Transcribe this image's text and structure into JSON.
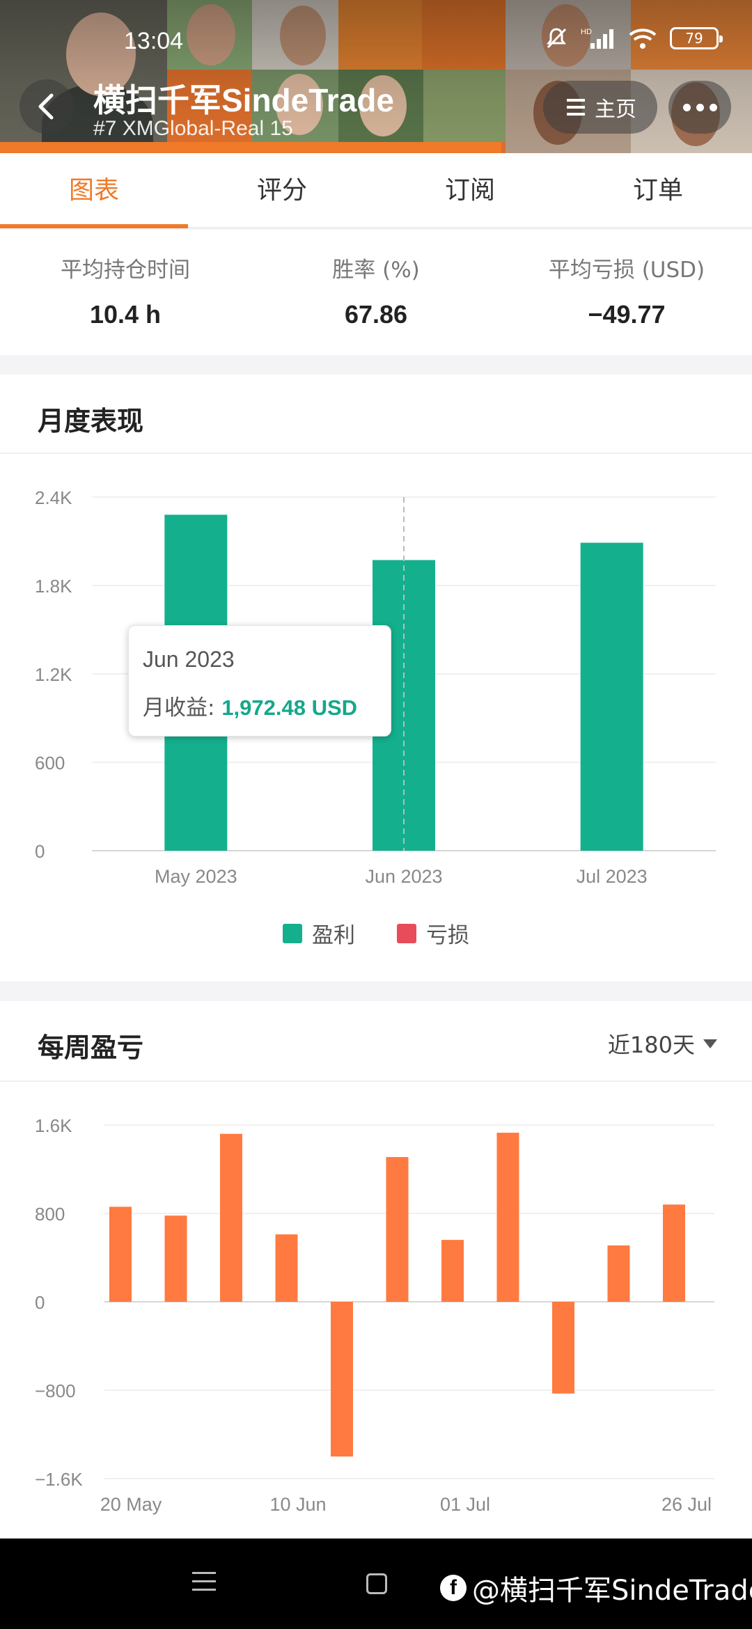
{
  "status_bar": {
    "time": "13:04",
    "battery": "79",
    "network_badge": "HD"
  },
  "header": {
    "title": "横扫千军SindeTrade",
    "subtitle": "#7  XMGlobal-Real 15",
    "home_label": "主页"
  },
  "tabs": [
    {
      "label": "图表",
      "active": true
    },
    {
      "label": "评分",
      "active": false
    },
    {
      "label": "订阅",
      "active": false
    },
    {
      "label": "订单",
      "active": false
    }
  ],
  "stats": [
    {
      "label": "平均持仓时间",
      "value": "10.4 h"
    },
    {
      "label": "胜率 (%)",
      "value": "67.86"
    },
    {
      "label": "平均亏损 (USD)",
      "value": "−49.77"
    }
  ],
  "monthly": {
    "title": "月度表现",
    "tooltip": {
      "date": "Jun 2023",
      "label": "月收益:",
      "value": "1,972.48 USD"
    },
    "legend": [
      {
        "name": "盈利",
        "color": "#14b08d"
      },
      {
        "name": "亏损",
        "color": "#e84c5a"
      }
    ]
  },
  "weekly": {
    "title": "每周盈亏",
    "range": "近180天"
  },
  "chart_data": [
    {
      "type": "bar",
      "title": "月度表现",
      "categories": [
        "May 2023",
        "Jun 2023",
        "Jul 2023"
      ],
      "values": [
        2280,
        1972.48,
        2090
      ],
      "ylim": [
        0,
        2400
      ],
      "yticks": [
        "0",
        "600",
        "1.2K",
        "1.8K",
        "2.4K"
      ],
      "ytick_values": [
        0,
        600,
        1200,
        1800,
        2400
      ],
      "color": "#14b08d",
      "grid": true,
      "legend": "bottom"
    },
    {
      "type": "bar",
      "title": "每周盈亏",
      "values": [
        860,
        780,
        1520,
        610,
        -1400,
        1310,
        560,
        1530,
        -830,
        510,
        880
      ],
      "xtick_labels": [
        "20 May",
        "10 Jun",
        "01 Jul",
        "26 Jul"
      ],
      "ylim": [
        -1600,
        1600
      ],
      "yticks": [
        "−1.6K",
        "−800",
        "0",
        "800",
        "1.6K"
      ],
      "ytick_values": [
        -1600,
        -800,
        0,
        800,
        1600
      ],
      "color": "#ff7a40",
      "grid": true
    }
  ],
  "watermark": "@横扫千军SindeTrade"
}
